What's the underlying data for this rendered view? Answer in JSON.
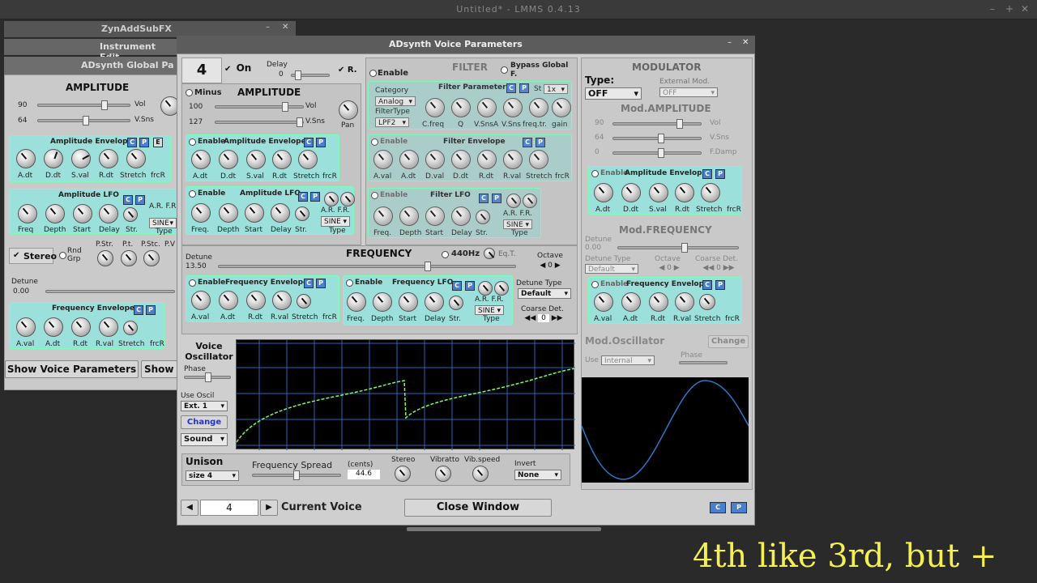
{
  "main_title": "Untitled* - LMMS 0.4.13",
  "windows": {
    "zyn": "ZynAddSubFX",
    "instrument": "Instrument Edit",
    "global": "ADsynth Global Pa",
    "voice": "ADsynth Voice Parameters"
  },
  "global": {
    "amplitude": "AMPLITUDE",
    "vol_label": "Vol",
    "vol_val": "90",
    "vsns_label": "V.Sns",
    "vsns_val": "64",
    "amp_env": "Amplitude Envelope",
    "amp_env_knobs": [
      "A.dt",
      "D.dt",
      "S.val",
      "R.dt",
      "Stretch",
      "frcR"
    ],
    "amp_lfo": "Amplitude LFO",
    "amp_lfo_knobs": [
      "Freq",
      "Depth",
      "Start",
      "Delay",
      "Str.",
      "C."
    ],
    "ar_fr": "A.R.  F.R.",
    "sine": "SINE",
    "type": "Type",
    "stereo": "Stereo",
    "rnd_grp": "Rnd\nGrp",
    "pan_knobs": [
      "P.Str.",
      "P.t.",
      "P.Stc.",
      "P.V"
    ],
    "detune": "Detune",
    "detune_val": "0.00",
    "freq_env": "Frequency Envelope",
    "freq_env_knobs": [
      "A.val",
      "A.dt",
      "R.dt",
      "R.val",
      "Stretch",
      "frcR"
    ],
    "show_voice": "Show Voice Parameters",
    "show": "Show"
  },
  "voice": {
    "number": "4",
    "on": "On",
    "delay": "Delay",
    "delay_val": "0",
    "r": "R.",
    "minus": "Minus",
    "amplitude": "AMPLITUDE",
    "vol": "Vol",
    "vol_val": "100",
    "vsns": "V.Sns",
    "vsns_val": "127",
    "pan": "Pan",
    "enable": "Enable",
    "amp_env": "Amplitude Envelope",
    "amp_env_knobs": [
      "A.dt",
      "D.dt",
      "S.val",
      "R.dt",
      "Stretch",
      "frcR"
    ],
    "amp_lfo": "Amplitude LFO",
    "lfo_knobs": [
      "Freq.",
      "Depth",
      "Start",
      "Delay",
      "Str.",
      "C."
    ],
    "ar_fr": "A.R.  F.R.",
    "sine": "SINE",
    "type": "Type",
    "filter": "FILTER",
    "bypass": "Bypass Global F.",
    "filter_params": "Filter Parameters",
    "category": "Category",
    "analog": "Analog",
    "filter_type": "FilterType",
    "lpf2": "LPF2",
    "st": "St",
    "st_val": "1x",
    "filter_knobs": [
      "C.freq",
      "Q",
      "V.SnsA",
      "V.Sns",
      "freq.tr.",
      "gain"
    ],
    "filter_env": "Filter Envelope",
    "filter_env_knobs": [
      "A.val",
      "A.dt",
      "D.val",
      "D.dt",
      "R.dt",
      "R.val",
      "Stretch",
      "frcR"
    ],
    "filter_lfo": "Filter LFO",
    "frequency": "FREQUENCY",
    "hz440": "440Hz",
    "eqt": "Eq.T.",
    "detune": "Detune",
    "detune_val": "13.50",
    "octave": "Octave",
    "octave_val": "0",
    "freq_env": "Frequency Envelope",
    "freq_env_knobs": [
      "A.val",
      "A.dt",
      "R.dt",
      "R.val",
      "Stretch",
      "frcR"
    ],
    "freq_lfo": "Frequency LFO",
    "detune_type": "Detune Type",
    "default": "Default",
    "coarse_det": "Coarse Det.",
    "coarse_val": "0",
    "voice_osc": "Voice Oscillator",
    "phase": "Phase",
    "use_oscil": "Use Oscil",
    "ext1": "Ext. 1",
    "change": "Change",
    "sound": "Sound",
    "unison": "Unison",
    "size4": "size 4",
    "freq_spread": "Frequency Spread",
    "cents": "(cents)",
    "cents_val": "44.6",
    "stereo": "Stereo",
    "vibratto": "Vibratto",
    "vib_speed": "Vib.speed",
    "invert": "Invert",
    "none": "None",
    "current_voice": "Current Voice",
    "voice_num": "4",
    "close": "Close Window",
    "c": "C",
    "p": "P"
  },
  "modulator": {
    "title": "MODULATOR",
    "type": "Type:",
    "off": "OFF",
    "ext_mod": "External Mod.",
    "ext_off": "OFF",
    "mod_amp": "Mod.AMPLITUDE",
    "vol": "Vol",
    "vol_val": "90",
    "vsns": "V.Sns",
    "vsns_val": "64",
    "fdamp": "F.Damp",
    "fdamp_val": "0",
    "amp_env": "Amplitude Envelope",
    "amp_env_knobs": [
      "A.dt",
      "D.dt",
      "S.val",
      "R.dt",
      "Stretch",
      "frcR"
    ],
    "mod_freq": "Mod.FREQUENCY",
    "detune": "Detune",
    "detune_val": "0.00",
    "detune_type": "Detune Type",
    "default": "Default",
    "octave": "Octave",
    "octave_val": "0",
    "coarse_det": "Coarse Det.",
    "coarse_val": "0",
    "freq_env": "Frequency Envelope",
    "freq_env_knobs": [
      "A.val",
      "A.dt",
      "R.dt",
      "R.val",
      "Stretch",
      "frcR"
    ],
    "mod_osc": "Mod.Oscillator",
    "change": "Change",
    "use": "Use",
    "internal": "Internal",
    "phase": "Phase"
  },
  "caption": "4th like 3rd, but +"
}
